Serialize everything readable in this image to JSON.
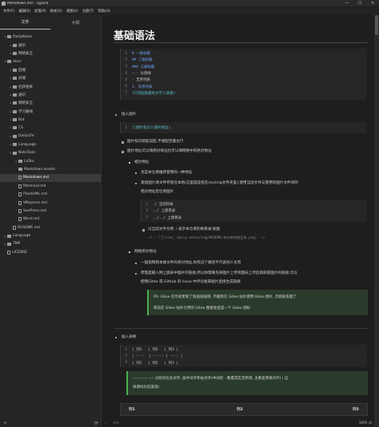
{
  "window": {
    "title": "Markdown.md - Typora",
    "controls": [
      "—",
      "☐",
      "✕"
    ]
  },
  "menu": [
    "文件(F)",
    "编辑(E)",
    "段落(P)",
    "格式(O)",
    "视图(V)",
    "主题(T)",
    "帮助(H)"
  ],
  "sidebar": {
    "tabs": [
      "文件",
      "大纲"
    ],
    "tree": [
      {
        "label": "DailyNotes",
        "depth": 0,
        "type": "folder",
        "caret": "▾"
      },
      {
        "label": "通识",
        "depth": 1,
        "type": "folder",
        "caret": "▸"
      },
      {
        "label": "网络安全",
        "depth": 1,
        "type": "folder",
        "caret": "▸"
      },
      {
        "label": "docs",
        "depth": 0,
        "type": "folder",
        "caret": "▾"
      },
      {
        "label": "后端",
        "depth": 1,
        "type": "folder",
        "caret": "▸"
      },
      {
        "label": "前端",
        "depth": 1,
        "type": "folder",
        "caret": "▸"
      },
      {
        "label": "杜跃相关",
        "depth": 1,
        "type": "folder",
        "caret": "▸"
      },
      {
        "label": "通识",
        "depth": 1,
        "type": "folder",
        "caret": "▸"
      },
      {
        "label": "网络安全",
        "depth": 1,
        "type": "folder",
        "caret": "▸"
      },
      {
        "label": "学习路线",
        "depth": 1,
        "type": "folder",
        "caret": "▸"
      },
      {
        "label": "Bot",
        "depth": 1,
        "type": "folder",
        "caret": "▸"
      },
      {
        "label": "CS",
        "depth": 1,
        "type": "folder",
        "caret": "▸"
      },
      {
        "label": "DailyLife",
        "depth": 1,
        "type": "folder",
        "caret": "▸"
      },
      {
        "label": "Language",
        "depth": 1,
        "type": "folder",
        "caret": "▸"
      },
      {
        "label": "NoteTools",
        "depth": 1,
        "type": "folder",
        "caret": "▾"
      },
      {
        "label": "LaTex",
        "depth": 2,
        "type": "folder",
        "caret": "▸"
      },
      {
        "label": "Markdown.assets",
        "depth": 2,
        "type": "folder",
        "caret": ""
      },
      {
        "label": "Markdown.md",
        "depth": 2,
        "type": "file",
        "caret": "",
        "active": true
      },
      {
        "label": "Mermaid.md",
        "depth": 2,
        "type": "file",
        "caret": ""
      },
      {
        "label": "PlantUML.md",
        "depth": 2,
        "type": "file",
        "caret": ""
      },
      {
        "label": "VNepress.md",
        "depth": 2,
        "type": "file",
        "caret": ""
      },
      {
        "label": "VuePress.md",
        "depth": 2,
        "type": "file",
        "caret": ""
      },
      {
        "label": "Word.md",
        "depth": 2,
        "type": "file",
        "caret": ""
      },
      {
        "label": "README.md",
        "depth": 1,
        "type": "file",
        "caret": ""
      },
      {
        "label": "Language",
        "depth": 0,
        "type": "folder",
        "caret": "▸"
      },
      {
        "label": "TMP",
        "depth": 0,
        "type": "folder",
        "caret": "▸"
      },
      {
        "label": "LICENSE",
        "depth": 0,
        "type": "file",
        "caret": ""
      }
    ],
    "footer_left": "+",
    "footer_right": "⟳"
  },
  "editor": {
    "heading": "基础语法",
    "code1": [
      {
        "n": "1",
        "text": "# 一级标题",
        "cls": "blue"
      },
      {
        "n": "2",
        "text": "## 二级标题",
        "cls": "blue"
      },
      {
        "n": "3",
        "text": "### 三级标题",
        "cls": "blue"
      },
      {
        "n": "4",
        "text": "--- 分割线",
        "cls": ""
      },
      {
        "n": "5",
        "text": "- 无序列表",
        "cls": ""
      },
      {
        "n": "6",
        "text": "1. 有序列表",
        "cls": "blue"
      },
      {
        "n": "7",
        "text": "[行内超链接的文字](链接)",
        "cls": "cyan"
      }
    ],
    "insert_image": "插入图片",
    "code2": [
      {
        "n": "1",
        "text": "![图片标识](图片地址)",
        "cls": "cyan"
      }
    ],
    "img_note1": "图片标识想起说起,不想起空着也行",
    "img_note2": "图片地址可以填相对地址也可以填网络中的绝对地址",
    "relative": "相对地址",
    "rel_note1": "也是本仓库推荐使用的一种地址",
    "rel_note2a": "意指图片源文件存放在本地(这里就是指在res/img文件夹里),使用当前文件与使用的图片文件间的",
    "rel_note2b": "相对地址定位到图片",
    "code3": [
      {
        "n": "1",
        "text": "./ 当前目录",
        "cls": ""
      },
      {
        "n": "2",
        "text": "../ 上级目录",
        "cls": ""
      },
      {
        "n": "3",
        "text": "../../ 上跳目录",
        "cls": ""
      }
    ],
    "rel_note3": "以当前文件为例 ./ 表示本仓库的根目录,如图",
    "rel_code": "<!-- ![](res_-daily-notes/img/README/本仓库的根目录.png) -->",
    "absolute": "网络绝对地址",
    "abs_note1": "一般指网络本质文件的绝对地址,你有这个路径不代表别人也有",
    "abs_note2a": "原理是输入网上图床中图片的链接,所以你需要先将图片上传到图床上然后再获取图片的链接,可以",
    "abs_note2b": "使用Gitee 或 Github 的 Issue 中评论框来图片直接生成链接",
    "quote": [
      "PS: Gitee 在年初更新了防盗链规则, 不推荐在 Gitee 站外使用 Gitee 图片, 否则就丢图了",
      "目前在 Gitee 站外引用的 Gitee 图链会变成一个 Gitee 图标"
    ],
    "insert_table": "插入表格",
    "code4": [
      {
        "n": "1",
        "text": "| 列1   | 列2   | 列3 |",
        "cls": ""
      },
      {
        "n": "2",
        "text": "| :---  | :---: | ---: |",
        "cls": ""
      },
      {
        "n": "3",
        "text": "| 列1   | 列2   | 列3 |",
        "cls": ""
      }
    ],
    "table_quote": [
      ":---, :---:, ---: 分别对应左对齐, 居中对齐和右对齐(中间的 - 数量其实无所谓, 主要是用来对齐) | 这",
      "样源码比较美观)"
    ],
    "table_head": [
      "列1",
      "列2",
      "列3"
    ]
  },
  "status": {
    "left": "‹",
    "mid": "</>",
    "right": "3896 词"
  }
}
